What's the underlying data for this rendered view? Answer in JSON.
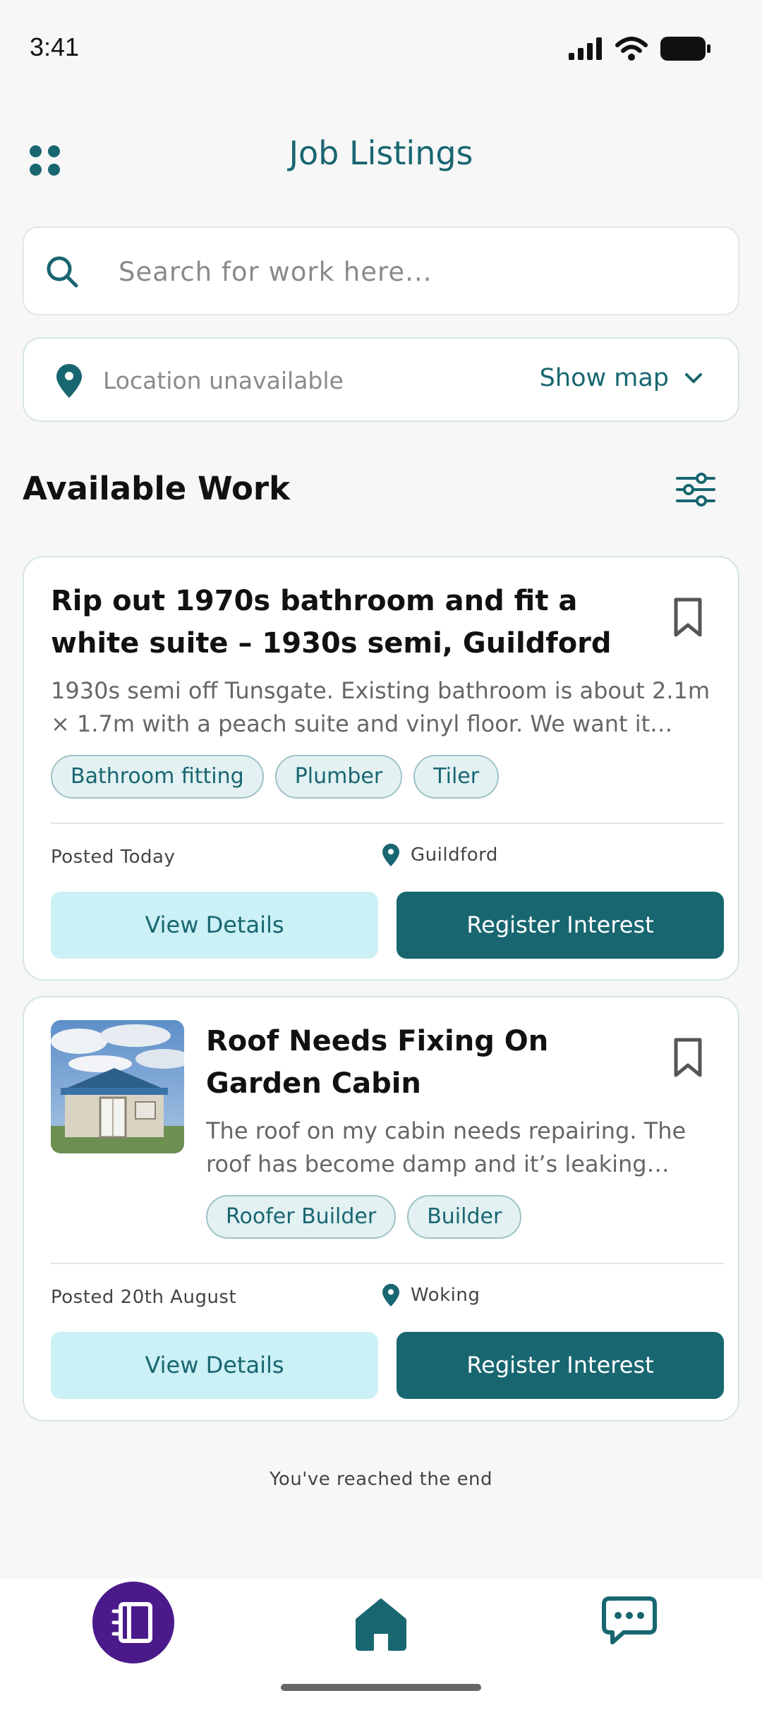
{
  "status_bar": {
    "time": "3:41"
  },
  "header": {
    "title": "Job Listings"
  },
  "search": {
    "placeholder": "Search for work here..."
  },
  "location": {
    "text": "Location unavailable",
    "show_map_label": "Show map"
  },
  "section": {
    "title": "Available Work"
  },
  "jobs": [
    {
      "title": "Rip out 1970s bathroom and fit a white suite – 1930s semi, Guildford",
      "description": "1930s semi off Tunsgate. Existing bathroom is about 2.1m × 1.7m with a peach suite and vinyl floor. We want it stripped out and a new white suite fitted.",
      "tags": [
        "Bathroom fitting",
        "Plumber",
        "Tiler"
      ],
      "posted": "Posted Today",
      "location": "Guildford",
      "view_label": "View Details",
      "register_label": "Register Interest"
    },
    {
      "title": "Roof Needs Fixing On Garden Cabin",
      "description": "The roof on my cabin needs repairing. The roof has become damp and it’s leaking through in places.",
      "tags": [
        "Roofer Builder",
        "Builder"
      ],
      "posted": "Posted 20th August",
      "location": "Woking",
      "view_label": "View Details",
      "register_label": "Register Interest"
    }
  ],
  "end_message": "You've reached the end",
  "nav": {
    "items": [
      "listings-icon",
      "home-icon",
      "chat-icon"
    ]
  },
  "colors": {
    "primary": "#186670",
    "light": "#cbf0f5",
    "nav_active": "#4a1a8a"
  }
}
